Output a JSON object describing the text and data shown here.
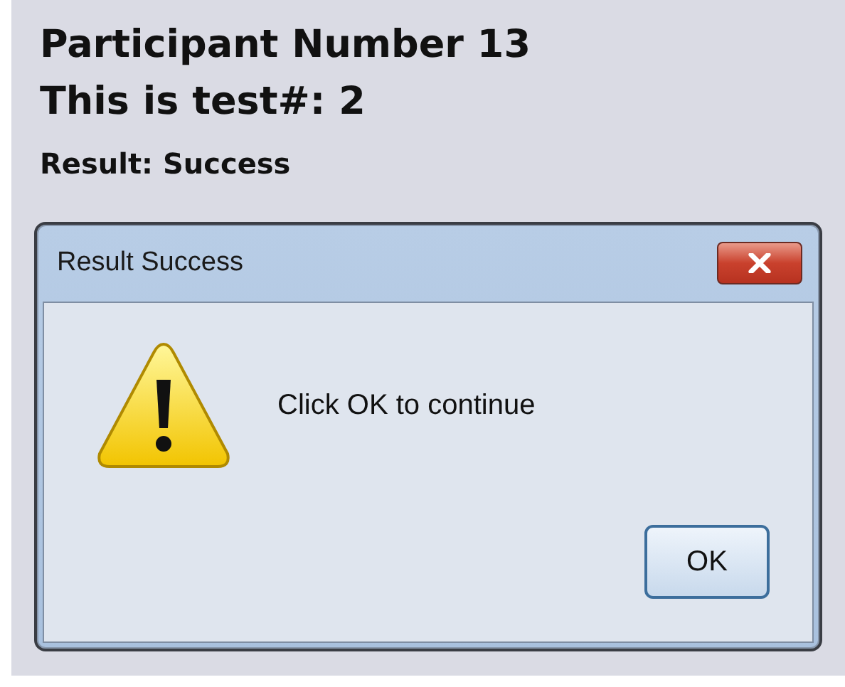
{
  "header": {
    "participant": "Participant Number 13",
    "test": "This is test#: 2",
    "result": "Result: Success"
  },
  "dialog": {
    "title": "Result Success",
    "message": "Click OK to continue",
    "buttons": [
      "OK"
    ]
  }
}
